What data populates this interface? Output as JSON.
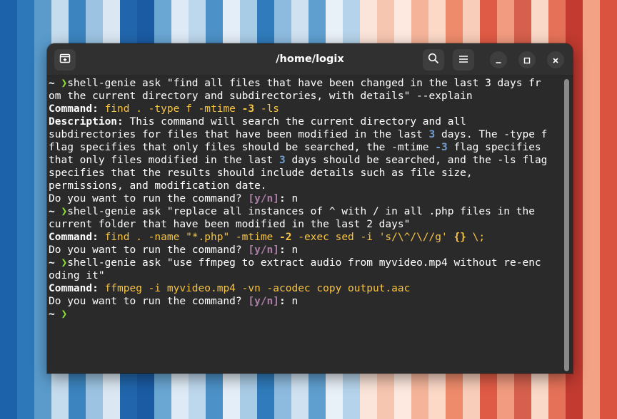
{
  "background": {
    "stripe_colors": [
      "#1b62ab",
      "#2d78b8",
      "#5a9bcc",
      "#c5dcee",
      "#3b84bf",
      "#9cc4e2",
      "#dbe8f3",
      "#2166ac",
      "#1a5ba3",
      "#6aa7d3",
      "#deebf6",
      "#bdd7ec",
      "#4c91c7",
      "#e4eef8",
      "#a9cce6",
      "#2f7bbb",
      "#8dbbe0",
      "#d0e2f1",
      "#5f9fd0",
      "#e8f0f8",
      "#b5d3ea",
      "#fbe4d9",
      "#f7c6b0",
      "#fde9df",
      "#f5b49a",
      "#fcd8c7",
      "#ee8b6b",
      "#f8cdb9",
      "#e05b45",
      "#f29b80",
      "#d6604d",
      "#fbd9c8",
      "#e57258",
      "#c23a30",
      "#f4a285",
      "#d9533f"
    ]
  },
  "window": {
    "title": "/home/logix",
    "new_tab_icon": "new-tab-icon",
    "search_icon": "search-icon",
    "menu_icon": "hamburger-menu-icon",
    "minimize_icon": "minimize-icon",
    "maximize_icon": "maximize-icon",
    "close_icon": "close-icon"
  },
  "colors": {
    "prompt_arrow": "#8ae234",
    "command": "#f6c343",
    "number": "#729fcf",
    "yn": "#ad7fa8",
    "text": "#ffffff",
    "terminal_bg": "#2a2a2a"
  },
  "terminal": {
    "lines": [
      [
        {
          "t": "~ ",
          "c": "prompt-tilde"
        },
        {
          "t": "❯",
          "c": "prompt-arrow"
        },
        {
          "t": "shell-genie ask \"find all files that have been changed in the last 3 days fr"
        }
      ],
      [
        {
          "t": "om the current directory and subdirectories, with details\" --explain"
        }
      ],
      [
        {
          "t": "Command: ",
          "c": "b"
        },
        {
          "t": "find . -type f -mtime ",
          "c": "cmd"
        },
        {
          "t": "-3",
          "c": "cmd b"
        },
        {
          "t": " -ls",
          "c": "cmd"
        }
      ],
      [
        {
          "t": "Description: ",
          "c": "b"
        },
        {
          "t": "This command will search the current directory and all"
        }
      ],
      [
        {
          "t": "subdirectories for files that have been modified in the last "
        },
        {
          "t": "3",
          "c": "num"
        },
        {
          "t": " days. The -type f"
        }
      ],
      [
        {
          "t": "flag specifies that only files should be searched, the -mtime "
        },
        {
          "t": "-3",
          "c": "num"
        },
        {
          "t": " flag specifies"
        }
      ],
      [
        {
          "t": "that only files modified in the last "
        },
        {
          "t": "3",
          "c": "num"
        },
        {
          "t": " days should be searched, and the -ls flag"
        }
      ],
      [
        {
          "t": "specifies that the results should include details such as file size,"
        }
      ],
      [
        {
          "t": "permissions, and modification date."
        }
      ],
      [
        {
          "t": "Do you want to run the command? "
        },
        {
          "t": "[y/n]",
          "c": "yn"
        },
        {
          "t": ": ",
          "c": "b"
        },
        {
          "t": "n"
        }
      ],
      [
        {
          "t": "~ ",
          "c": "prompt-tilde"
        },
        {
          "t": "❯",
          "c": "prompt-arrow"
        },
        {
          "t": "shell-genie ask \"replace all instances of ^ with / in all .php files in the"
        }
      ],
      [
        {
          "t": "current folder that have been modified in the last 2 days\""
        }
      ],
      [
        {
          "t": "Command: ",
          "c": "b"
        },
        {
          "t": "find . -name \"*.php\" -mtime ",
          "c": "cmd"
        },
        {
          "t": "-2",
          "c": "cmd b"
        },
        {
          "t": " -exec sed -i 's/\\^/\\//g' ",
          "c": "cmd"
        },
        {
          "t": "{}",
          "c": "cmd b"
        },
        {
          "t": " \\;",
          "c": "cmd"
        }
      ],
      [
        {
          "t": "Do you want to run the command? "
        },
        {
          "t": "[y/n]",
          "c": "yn"
        },
        {
          "t": ": ",
          "c": "b"
        },
        {
          "t": "n"
        }
      ],
      [
        {
          "t": "~ ",
          "c": "prompt-tilde"
        },
        {
          "t": "❯",
          "c": "prompt-arrow"
        },
        {
          "t": "shell-genie ask \"use ffmpeg to extract audio from myvideo.mp4 without re-enc"
        }
      ],
      [
        {
          "t": "oding it\""
        }
      ],
      [
        {
          "t": "Command: ",
          "c": "b"
        },
        {
          "t": "ffmpeg -i myvideo.mp4 -vn -acodec copy output.aac",
          "c": "cmd"
        }
      ],
      [
        {
          "t": "Do you want to run the command? "
        },
        {
          "t": "[y/n]",
          "c": "yn"
        },
        {
          "t": ": ",
          "c": "b"
        },
        {
          "t": "n"
        }
      ],
      [
        {
          "t": "~ ",
          "c": "prompt-tilde"
        },
        {
          "t": "❯",
          "c": "prompt-arrow"
        }
      ]
    ]
  }
}
